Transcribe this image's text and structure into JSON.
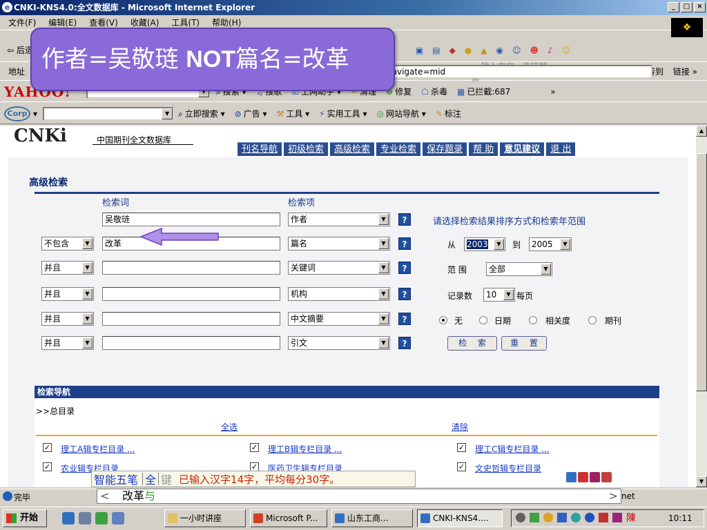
{
  "window": {
    "title": "CNKI-KNS4.0:全文数据库 - Microsoft Internet Explorer",
    "buttons": [
      "_",
      "□",
      "×"
    ]
  },
  "menu": [
    "文件(F)",
    "编辑(E)",
    "查看(V)",
    "收藏(A)",
    "工具(T)",
    "帮助(H)"
  ],
  "toolbar": {
    "back_label": "⇦ 后退",
    "address_label": "地址",
    "address_value": "navigate=mid",
    "search_hint": "输入中文，直接搜索",
    "go_label": "转到",
    "links_label": "链接"
  },
  "yahoo_bar": {
    "logo": "YAHOO!",
    "items": [
      "搜索",
      "搜歌",
      "上网助手",
      "清理",
      "修复",
      "杀毒",
      "已拦截:687"
    ]
  },
  "corp_bar": {
    "logo": "Corp",
    "items": [
      "立即搜索",
      "广告",
      "工具",
      "实用工具",
      "网站导航",
      "标注"
    ]
  },
  "site": {
    "logo": "CNKi",
    "name": "中国期刊全文数据库",
    "nav": [
      "刊名导航",
      "初级检索",
      "高级检索",
      "专业检索",
      "保存题录",
      "帮 助",
      "意见建议",
      "退 出"
    ]
  },
  "search": {
    "title": "高级检索",
    "term_header": "检索词",
    "field_header": "检索项",
    "help_symbol": "?",
    "rows": [
      {
        "op": "",
        "term": "吴敬琏",
        "field": "作者"
      },
      {
        "op": "不包含",
        "term": "改革",
        "field": "篇名"
      },
      {
        "op": "并且",
        "term": "",
        "field": "关键词"
      },
      {
        "op": "并且",
        "term": "",
        "field": "机构"
      },
      {
        "op": "并且",
        "term": "",
        "field": "中文摘要"
      },
      {
        "op": "并且",
        "term": "",
        "field": "引文"
      }
    ]
  },
  "options": {
    "hint": "请选择检索结果排序方式和检索年范围",
    "from_label": "从",
    "from_year": "2003",
    "to_label": "到",
    "to_year": "2005",
    "range_label": "范 围",
    "range_value": "全部",
    "records_label": "记录数",
    "records_value": "10",
    "per_page_label": "每页",
    "sort_options": [
      "无",
      "日期",
      "相关度",
      "期刊"
    ],
    "sort_selected": "无",
    "search_button": "检 索",
    "reset_button": "重 置"
  },
  "nav_section": {
    "title": "检索导航",
    "root": ">>总目录",
    "select_all": "全选",
    "clear": "清除",
    "categories": [
      "理工A辑专栏目录 ...",
      "理工B辑专栏目录 ...",
      "理工C辑专栏目录 ...",
      "农业辑专栏目录",
      "医药卫生辑专栏目录",
      "文史哲辑专栏目录"
    ]
  },
  "ime": {
    "name": "智能五笔",
    "full": "全",
    "key": "键",
    "status": "已输入汉字14字，平均每分30字。",
    "typed": "改革",
    "pending": "与"
  },
  "statusbar": {
    "text": "完毕",
    "zone": "net"
  },
  "taskbar": {
    "start": "开始",
    "buttons": [
      "一小时讲座",
      "Microsoft P...",
      "山东工商...",
      "CNKI-KNS4...."
    ],
    "clock": "10:11"
  },
  "callout": {
    "pre": "作者=吴敬琏 ",
    "op": "NOT",
    "post": "篇名=改革"
  },
  "colors": {
    "nav_tab": "#2a4d8f",
    "callout": "#8a6ad8",
    "arrow": "#b090e8"
  }
}
